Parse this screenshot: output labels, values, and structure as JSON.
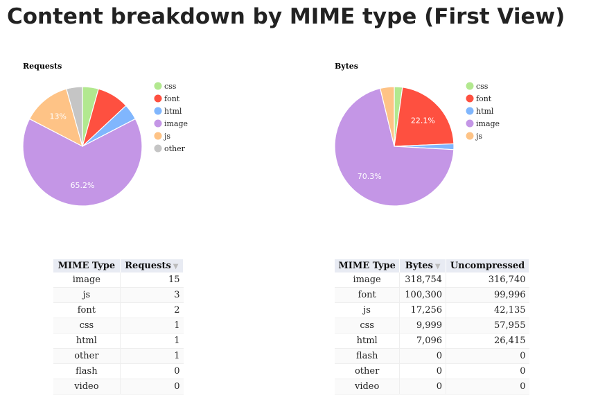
{
  "page": {
    "title": "Content breakdown by MIME type (First View)"
  },
  "chart_data": [
    {
      "type": "pie",
      "title": "Requests",
      "categories": [
        "css",
        "font",
        "html",
        "image",
        "js",
        "other"
      ],
      "values": [
        1,
        2,
        1,
        15,
        3,
        1
      ],
      "colors": [
        "#b2e88f",
        "#fe5040",
        "#80b6fd",
        "#c496e6",
        "#fec386",
        "#c5c5c5"
      ],
      "slice_labels": {
        "image": "65.2%",
        "js": "13%"
      },
      "legend": [
        "css",
        "font",
        "html",
        "image",
        "js",
        "other"
      ],
      "legend_position": "right"
    },
    {
      "type": "pie",
      "title": "Bytes",
      "categories": [
        "css",
        "font",
        "html",
        "image",
        "js"
      ],
      "values": [
        9999,
        100300,
        7096,
        318754,
        17256
      ],
      "colors": [
        "#b2e88f",
        "#fe5040",
        "#80b6fd",
        "#c496e6",
        "#fec386"
      ],
      "slice_labels": {
        "image": "70.3%",
        "font": "22.1%"
      },
      "legend": [
        "css",
        "font",
        "html",
        "image",
        "js"
      ],
      "legend_position": "right"
    }
  ],
  "requests_table": {
    "headers": [
      "MIME Type",
      "Requests"
    ],
    "sort_indicator": "▼",
    "rows": [
      [
        "image",
        "15"
      ],
      [
        "js",
        "3"
      ],
      [
        "font",
        "2"
      ],
      [
        "css",
        "1"
      ],
      [
        "html",
        "1"
      ],
      [
        "other",
        "1"
      ],
      [
        "flash",
        "0"
      ],
      [
        "video",
        "0"
      ]
    ]
  },
  "bytes_table": {
    "headers": [
      "MIME Type",
      "Bytes",
      "Uncompressed"
    ],
    "sort_indicator": "▼",
    "rows": [
      [
        "image",
        "318,754",
        "316,740"
      ],
      [
        "font",
        "100,300",
        "99,996"
      ],
      [
        "js",
        "17,256",
        "42,135"
      ],
      [
        "css",
        "9,999",
        "57,955"
      ],
      [
        "html",
        "7,096",
        "26,415"
      ],
      [
        "flash",
        "0",
        "0"
      ],
      [
        "other",
        "0",
        "0"
      ],
      [
        "video",
        "0",
        "0"
      ]
    ]
  }
}
